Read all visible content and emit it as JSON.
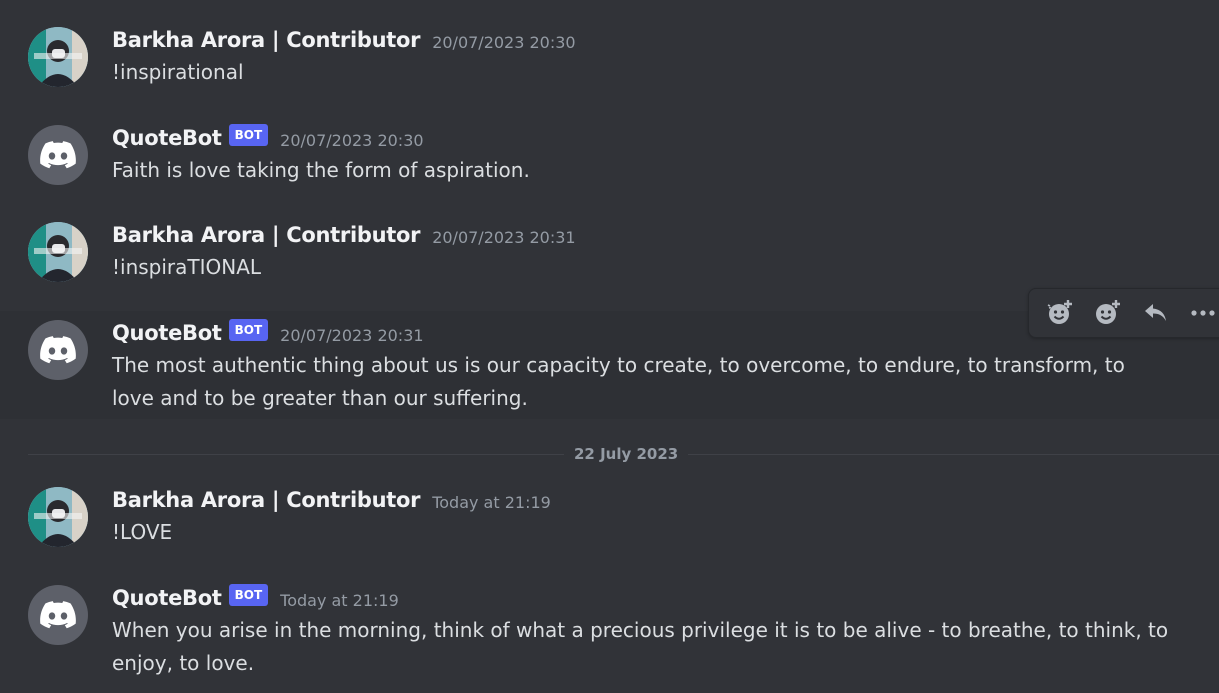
{
  "messages": [
    {
      "author": "Barkha Arora | Contributor",
      "timestamp": "20/07/2023 20:30",
      "content": "!inspirational",
      "is_bot": false
    },
    {
      "author": "QuoteBot",
      "bot_tag": "BOT",
      "timestamp": "20/07/2023 20:30",
      "content": "Faith is love taking the form of aspiration.",
      "is_bot": true
    },
    {
      "author": "Barkha Arora | Contributor",
      "timestamp": "20/07/2023 20:31",
      "content": "!inspiraTIONAL",
      "is_bot": false
    },
    {
      "author": "QuoteBot",
      "bot_tag": "BOT",
      "timestamp": "20/07/2023 20:31",
      "content": "The most authentic thing about us is our capacity to create, to overcome, to endure, to transform, to love and to be greater than our suffering.",
      "is_bot": true
    },
    {
      "author": "Barkha Arora | Contributor",
      "timestamp": "Today at 21:19",
      "content": "!LOVE",
      "is_bot": false
    },
    {
      "author": "QuoteBot",
      "bot_tag": "BOT",
      "timestamp": "Today at 21:19",
      "content": "When you arise in the morning, think of what a precious privilege it is to be alive - to breathe, to think, to enjoy, to love.",
      "is_bot": true
    }
  ],
  "date_divider": "22 July 2023",
  "toolbar": {
    "icons": [
      "add-super-reaction-icon",
      "add-reaction-icon",
      "reply-icon",
      "more-icon"
    ]
  },
  "colors": {
    "background": "#313338",
    "text": "#dbdee1",
    "author": "#f2f3f5",
    "timestamp": "#949ba4",
    "bot_tag": "#5865f2"
  }
}
